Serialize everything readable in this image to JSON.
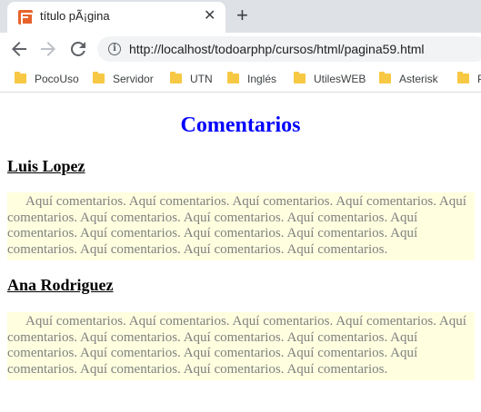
{
  "browser": {
    "tab_title": "título pÃ¡gina",
    "tab_close": "✕",
    "new_tab": "+",
    "url": "http://localhost/todoarphp/cursos/html/pagina59.html",
    "icons": {
      "back": "arrow-left-icon",
      "forward": "arrow-right-icon",
      "reload": "reload-icon",
      "info": "info-icon",
      "favicon": "xampp-favicon-icon"
    },
    "bookmarks": [
      "PocoUso",
      "Servidor",
      "UTN",
      "Inglés",
      "UtilesWEB",
      "Asterisk",
      "Pe"
    ]
  },
  "page": {
    "title": "Comentarios",
    "title_color": "#0000ff",
    "comment_bg": "#ffffe0",
    "comments": [
      {
        "author": "Luis Lopez",
        "text": "Aquí comentarios. Aquí comentarios. Aquí comentarios. Aquí comentarios. Aquí comentarios. Aquí comentarios. Aquí comentarios. Aquí comentarios. Aquí comentarios. Aquí comentarios. Aquí comentarios. Aquí comentarios. Aquí comentarios. Aquí comentarios. Aquí comentarios. Aquí comentarios."
      },
      {
        "author": "Ana Rodriguez",
        "text": "Aquí comentarios. Aquí comentarios. Aquí comentarios. Aquí comentarios. Aquí comentarios. Aquí comentarios. Aquí comentarios. Aquí comentarios. Aquí comentarios. Aquí comentarios. Aquí comentarios. Aquí comentarios. Aquí comentarios. Aquí comentarios. Aquí comentarios. Aquí comentarios."
      }
    ]
  }
}
